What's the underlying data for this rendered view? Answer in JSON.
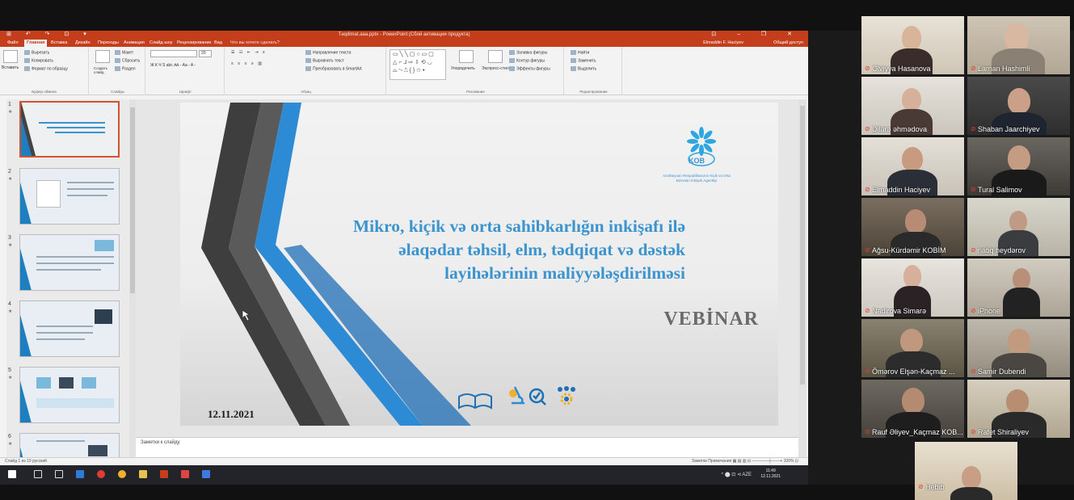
{
  "window": {
    "title": "Təqdimat.aaa.pptx - PowerPoint (Сбой активации продукта)",
    "quick_access": "⊞ ↶ ↷ ⊡ ▾",
    "controls": "⊡ – ❐ ✕"
  },
  "tabs": [
    "Файл",
    "Главная",
    "Вставка",
    "Дизайн",
    "Переходы",
    "Анимация",
    "Слайд-шоу",
    "Рецензирование",
    "Вид",
    "Что вы хотите сделать?"
  ],
  "active_tab": "Главная",
  "user_name": "Elmaddin F. Haciyev",
  "share_label": "Общий доступ",
  "ribbon": {
    "clipboard": {
      "paste": "Вставить",
      "cut": "Вырезать",
      "copy": "Копировать",
      "format": "Формат по образцу",
      "label": "Буфер обмена"
    },
    "slides": {
      "new": "Создать слайд",
      "layout": "Макет",
      "reset": "Сбросить",
      "section": "Раздел",
      "label": "Слайды"
    },
    "font": {
      "name": "",
      "size": "20",
      "label": "Шрифт",
      "row2": "Ж К Ч S abc Ꜳ - Aa - A -"
    },
    "paragraph": {
      "label": "Абзац",
      "dir": "Направление текста",
      "align": "Выровнять текст",
      "smart": "Преобразовать в SmartArt"
    },
    "drawing": {
      "arrange": "Упорядочить",
      "styles": "Экспресс-стили",
      "fill": "Заливка фигуры",
      "outline": "Контур фигуры",
      "effects": "Эффекты фигуры",
      "label": "Рисование",
      "shapes_r1": "▭ ╲ ╲ ▢ ○ ▭ ▢",
      "shapes_r2": "△ ⌐ ⅃ ⇨ ⇩ ⟲ ◡",
      "shapes_r3": "⌓ ∿ ⎍ { } ☆ ▾"
    },
    "editing": {
      "find": "Найти",
      "replace": "Заменить",
      "select": "Выделить",
      "label": "Редактирование"
    }
  },
  "thumbnails": [
    {
      "num": "1",
      "star": "★"
    },
    {
      "num": "2",
      "star": "★"
    },
    {
      "num": "3",
      "star": "★"
    },
    {
      "num": "4",
      "star": "★"
    },
    {
      "num": "5",
      "star": "★"
    },
    {
      "num": "6",
      "star": "★"
    }
  ],
  "slide": {
    "title_lines": [
      "Mikro, kiçik və orta sahibkarlığın inkişafı ilə",
      "əlaqədar təhsil, elm, tədqiqat və dəstək",
      "layihələrinin maliyyələşdirilməsi"
    ],
    "subtitle": "VEBİNAR",
    "date": "12.11.2021",
    "logo_text": "KOB",
    "logo_org": "Azərbaycan Respublikasının Kiçik və Orta Biznesin İnkişafı Agentliyi"
  },
  "notes_placeholder": "Заметки к слайду",
  "status": {
    "slide_info": "Слайд 1 из 19",
    "lang": "русский",
    "right": "Заметки   Примечания   ▦  ▤  ▥  ⊟   −─────┼───+  100%  ⊡"
  },
  "taskbar": {
    "tray": "^ ⬤ ⊡ ⊲ AZE",
    "time": "11:49",
    "date": "12.11.2021"
  },
  "participants": [
    {
      "name": "Olviyya Hasanova"
    },
    {
      "name": "Laman Hashimli"
    },
    {
      "name": "Dilarə əhmədova"
    },
    {
      "name": "Shaban Jaarchiyev"
    },
    {
      "name": "Elmaddin Haciyev"
    },
    {
      "name": "Tural Salimov"
    },
    {
      "name": "Ağsu-Kürdəmir KOBİM"
    },
    {
      "name": "natiq heydərov"
    },
    {
      "name": "Nadirova Simarə"
    },
    {
      "name": "iPhone"
    },
    {
      "name": "Ömərov Elşən-Kaçmaz ..."
    },
    {
      "name": "Samir Dubendi"
    },
    {
      "name": "Rauf Əliyev_Kaçmaz KOB..."
    },
    {
      "name": "Rafet Shiraliyev"
    },
    {
      "name": "Hebib"
    }
  ],
  "colors": {
    "ppt_accent": "#c43e1c",
    "slide_title": "#3c94cf",
    "speaking_outline": "#b6d15d",
    "muted_mic": "#e03c31"
  }
}
